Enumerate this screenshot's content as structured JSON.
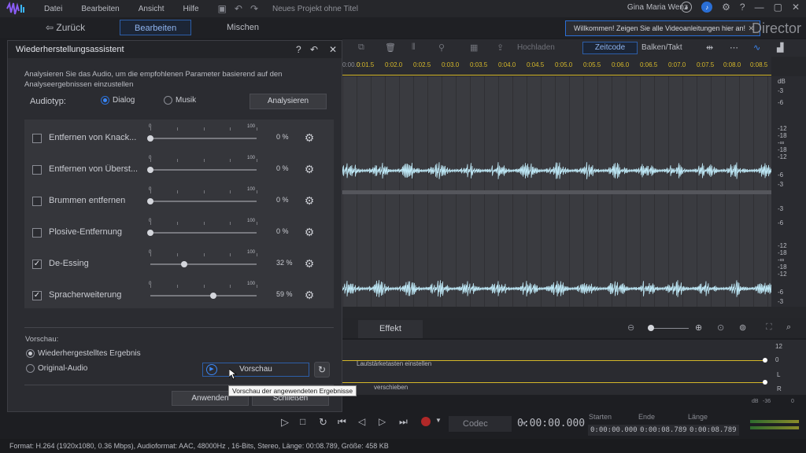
{
  "menu": {
    "items": [
      "Datei",
      "Bearbeiten",
      "Ansicht",
      "Hilfe"
    ],
    "project_title": "Neues Projekt ohne Titel",
    "user_name": "Gina Maria Wenz",
    "help": "?"
  },
  "nav": {
    "back": "Zurück",
    "edit_tab": "Bearbeiten",
    "mix_tab": "Mischen"
  },
  "welcome_banner": "Willkommen! Zeigen Sie alle Videoanleitungen hier an!",
  "brand_fragment": "Director",
  "editor": {
    "upload": "Hochladen",
    "timecode_btn": "Zeitcode",
    "bars_btn": "Balken/Takt",
    "ruler": [
      "0:00.0",
      "0:01.5",
      "0:02.0",
      "0:02.5",
      "0:03.0",
      "0:03.5",
      "0:04.0",
      "0:04.5",
      "0:05.0",
      "0:05.5",
      "0:06.0",
      "0:06.5",
      "0:07.0",
      "0:07.5",
      "0:08.0",
      "0:08.5"
    ],
    "db_labels_top": [
      "dB",
      "-3",
      "-6",
      "-12",
      "-18",
      "-∞",
      "-18",
      "-12",
      "-6",
      "-3"
    ],
    "db_labels_bottom": [
      "-3",
      "-6",
      "-12",
      "-18",
      "-∞",
      "-18",
      "-12",
      "-6",
      "-3"
    ],
    "effect_tab": "Effekt"
  },
  "lower": {
    "db_top": "12",
    "zero": "0",
    "db_12": "12",
    "volume_hint": "Lautstärketasten einstellen",
    "pan_hint": "verschieben",
    "l_label": "L",
    "r_label": "R",
    "db_right": "dB",
    "minus36": "-36",
    "zero2": "0"
  },
  "player": {
    "codec": "Codec",
    "timecode": "0:00:00.000",
    "start_label": "Starten",
    "end_label": "Ende",
    "length_label": "Länge",
    "start_val": "0:00:00.000",
    "end_val": "0:00:08.789",
    "length_val": "0:00:08.789"
  },
  "status": "Format: H.264 (1920x1080, 0.36 Mbps), Audioformat: AAC, 48000Hz , 16-Bits, Stereo, Länge: 00:08.789, Größe: 458 KB",
  "dialog": {
    "title": "Wiederherstellungsassistent",
    "help": "?",
    "description": "Analysieren Sie das Audio, um die empfohlenen Parameter basierend auf den Analyseergebnissen einzustellen",
    "audiotype_label": "Audiotyp:",
    "radio_dialog": "Dialog",
    "radio_music": "Musik",
    "analyze_btn": "Analysieren",
    "params": [
      {
        "label": "Entfernen von Knack...",
        "checked": false,
        "value": 0,
        "pct": "0 %"
      },
      {
        "label": "Entfernen von Überst...",
        "checked": false,
        "value": 0,
        "pct": "0 %"
      },
      {
        "label": "Brummen entfernen",
        "checked": false,
        "value": 0,
        "pct": "0 %"
      },
      {
        "label": "Plosive-Entfernung",
        "checked": false,
        "value": 0,
        "pct": "0 %"
      },
      {
        "label": "De-Essing",
        "checked": true,
        "value": 32,
        "pct": "32 %"
      },
      {
        "label": "Spracherweiterung",
        "checked": true,
        "value": 59,
        "pct": "59 %"
      }
    ],
    "slider_min": "0",
    "slider_max": "100",
    "preview_label": "Vorschau:",
    "radio_restored": "Wiederhergestelltes Ergebnis",
    "radio_original": "Original-Audio",
    "preview_btn": "Vorschau",
    "apply_btn": "Anwenden",
    "close_btn": "Schließen",
    "tooltip": "Vorschau der angewendeten Ergebnisse"
  }
}
